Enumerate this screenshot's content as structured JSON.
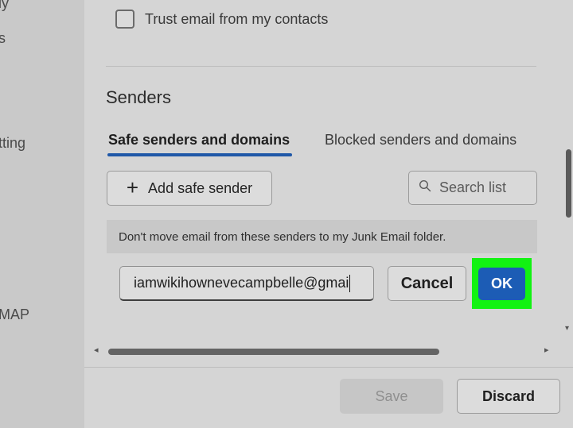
{
  "left_nav": {
    "fragments": [
      "ly",
      "s",
      "tting",
      "MAP"
    ]
  },
  "trust": {
    "label": "Trust email from my contacts",
    "checked": false
  },
  "senders": {
    "title": "Senders",
    "tabs": [
      {
        "label": "Safe senders and domains",
        "selected": true
      },
      {
        "label": "Blocked senders and domains",
        "selected": false
      }
    ],
    "add_button": {
      "icon": "plus-icon",
      "label": "Add safe sender"
    },
    "search": {
      "icon": "search-icon",
      "placeholder": "Search list"
    },
    "info_text": "Don't move email from these senders to my Junk Email folder.",
    "email_input": {
      "value": "iamwikihownevecampbelle@gmai"
    },
    "cancel_label": "Cancel",
    "ok_label": "OK"
  },
  "footer": {
    "save_label": "Save",
    "discard_label": "Discard"
  },
  "colors": {
    "accent": "#1c5cb5",
    "highlight": "#12f212",
    "tab_underline": "#1f58a8"
  }
}
